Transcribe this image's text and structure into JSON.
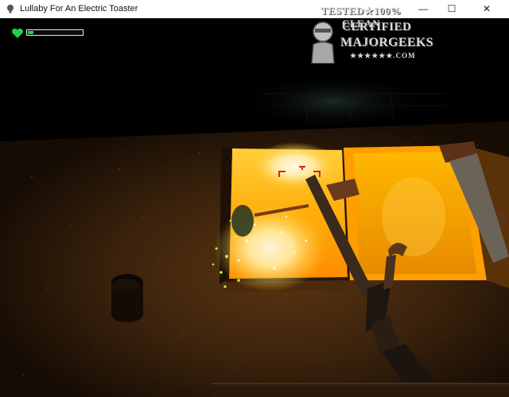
{
  "window": {
    "title": "Lullaby For An Electric Toaster",
    "icon": "app-icon",
    "buttons": {
      "minimize": "—",
      "maximize": "☐",
      "close": "✕"
    }
  },
  "hud": {
    "health_icon": "heart-icon",
    "health_color": "#22d04a",
    "health_fraction": 0.1
  },
  "watermark": {
    "line1": "TESTED★100% CLEAN",
    "certified": "CERTIFIED",
    "brand": "MAJORGEEKS",
    "stars": "★★★★★★.COM"
  }
}
